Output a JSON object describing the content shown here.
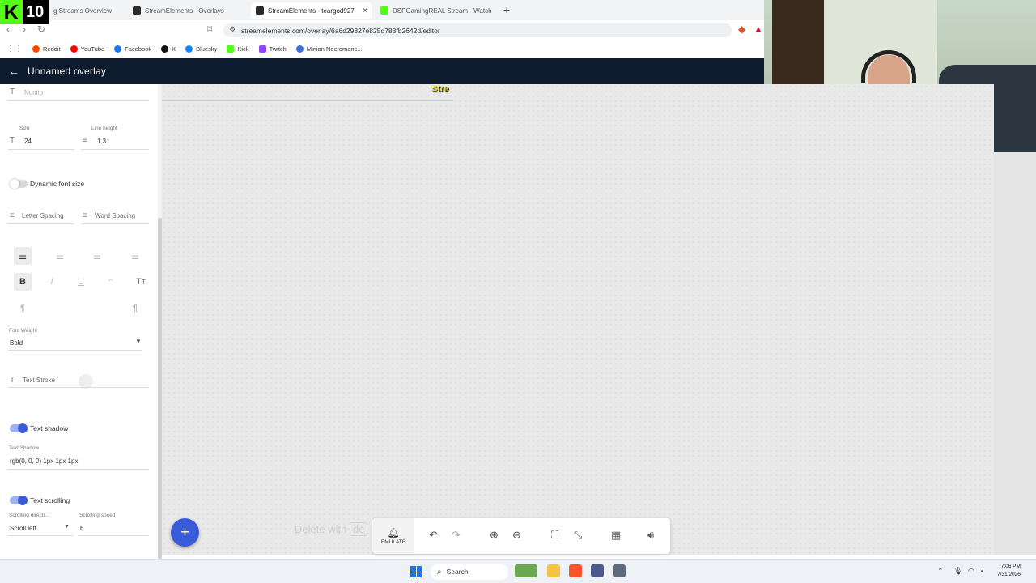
{
  "overlay_badge": {
    "k": "K",
    "number": "10"
  },
  "browser": {
    "tabs": [
      {
        "label": "g Streams Overview",
        "active": false,
        "color": "#2b2b2b"
      },
      {
        "label": "StreamElements - Overlays",
        "active": false,
        "color": "#2b2b2b"
      },
      {
        "label": "StreamElements - teargod927",
        "active": true,
        "color": "#2b2b2b"
      },
      {
        "label": "DSPGamingREAL Stream - Watch",
        "active": false,
        "color": "#53fc18"
      }
    ],
    "close_glyph": "×",
    "new_tab_glyph": "+",
    "url": "streamelements.com/overlay/6a6d29327e825d783fb2642d/editor",
    "bookmarks": [
      {
        "label": "Reddit",
        "color": "#ff4500"
      },
      {
        "label": "YouTube",
        "color": "#ff0000"
      },
      {
        "label": "Facebook",
        "color": "#1877f2"
      },
      {
        "label": "X",
        "color": "#111111"
      },
      {
        "label": "Bluesky",
        "color": "#1185fe"
      },
      {
        "label": "Kick",
        "color": "#53fc18"
      },
      {
        "label": "Twitch",
        "color": "#9146ff"
      },
      {
        "label": "Minion Necromanc...",
        "color": "#3a6fd8"
      }
    ]
  },
  "editor": {
    "title": "Unnamed overlay",
    "font_family": "Nunito",
    "size_label": "Size",
    "size_value": "24",
    "line_height_label": "Line height",
    "line_height_value": "1.3",
    "dynamic_font_size_label": "Dynamic font size",
    "dynamic_font_size_on": false,
    "letter_spacing_label": "Letter Spacing",
    "word_spacing_label": "Word Spacing",
    "font_weight_label": "Font Weight",
    "font_weight_value": "Bold",
    "text_stroke_label": "Text Stroke",
    "text_shadow_toggle_label": "Text shadow",
    "text_shadow_on": true,
    "text_shadow_field_label": "Text Shadow",
    "text_shadow_value": "rgb(0, 0, 0) 1px 1px 1px",
    "text_scrolling_label": "Text scrolling",
    "text_scrolling_on": true,
    "scrolling_direction_label": "Scrolling directi...",
    "scrolling_direction_value": "Scroll left",
    "scrolling_speed_label": "Scrolling speed",
    "scrolling_speed_value": "6",
    "accent_color": "#3a5bd9"
  },
  "canvas": {
    "widget_text": "Stre",
    "delete_hint_prefix": "Delete with",
    "delete_hint_key": "de"
  },
  "toolbar": {
    "emulate_label": "EMULATE"
  },
  "fab_label": "+",
  "taskbar": {
    "search_label": "Search",
    "time": "7:06 PM",
    "date": "7/31/2026"
  }
}
